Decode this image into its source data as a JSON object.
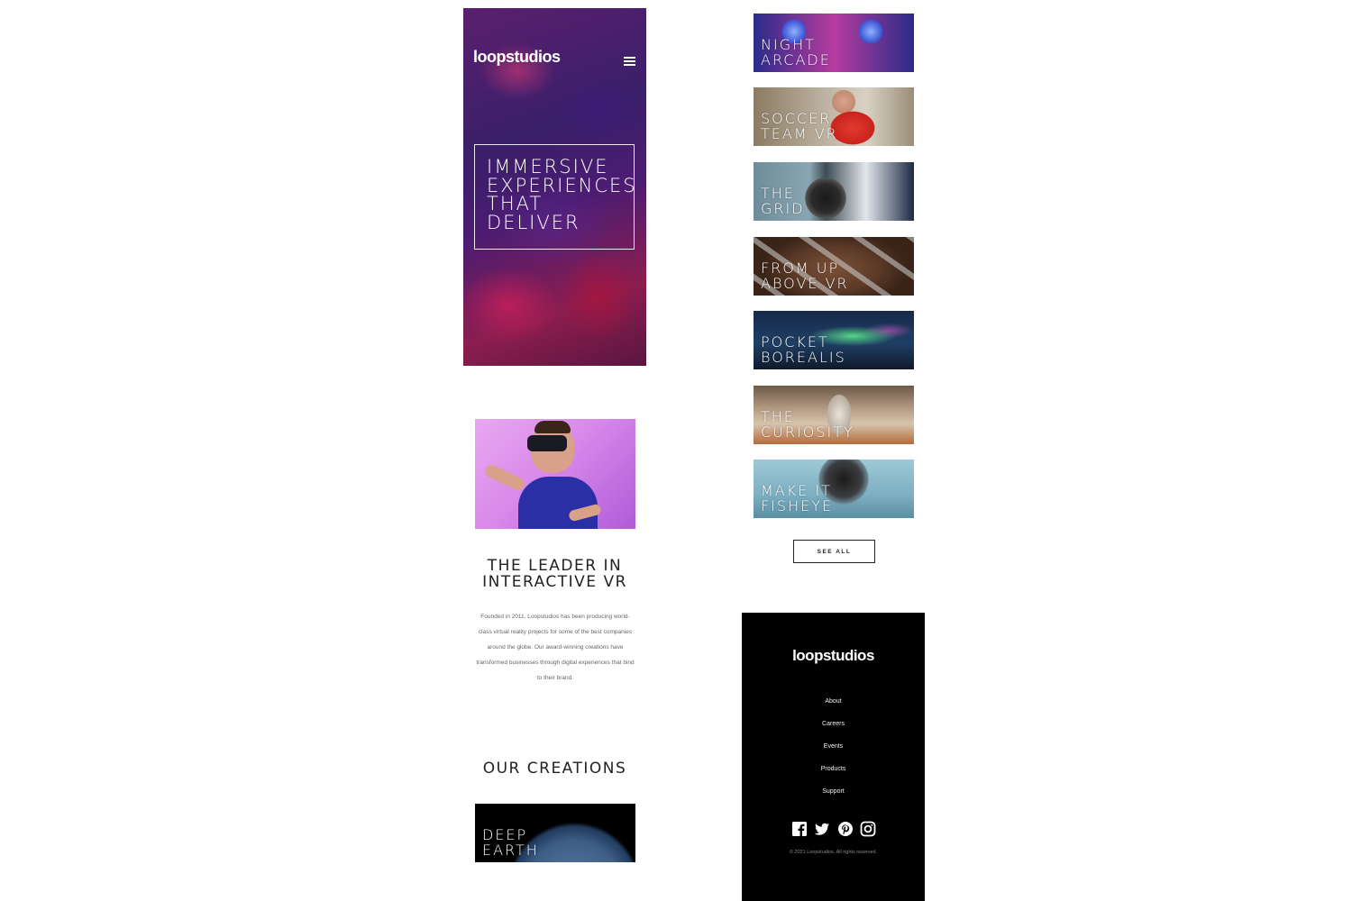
{
  "brand": {
    "name": "loopstudios"
  },
  "hero": {
    "title": "IMMERSIVE\nEXPERIENCES\nTHAT\nDELIVER",
    "menu_icon": "hamburger-icon"
  },
  "interactive": {
    "title": "THE LEADER IN\nINTERACTIVE VR",
    "text": "Founded in 2011, Loopstudios has been producing world-class virtual reality projects for some of the best companies around the globe. Our award-winning creations have transformed businesses through digital experiences that bind to their brand."
  },
  "creations": {
    "title": "OUR CREATIONS",
    "items": [
      {
        "label": "DEEP\nEARTH"
      },
      {
        "label": "NIGHT\nARCADE"
      },
      {
        "label": "SOCCER\nTEAM VR"
      },
      {
        "label": "THE\nGRID"
      },
      {
        "label": "FROM UP\nABOVE VR"
      },
      {
        "label": "POCKET\nBOREALIS"
      },
      {
        "label": "THE\nCURIOSITY"
      },
      {
        "label": "MAKE IT\nFISHEYE"
      }
    ],
    "see_all": "SEE ALL"
  },
  "footer": {
    "logo": "loopstudios",
    "nav": [
      "About",
      "Careers",
      "Events",
      "Products",
      "Support"
    ],
    "socials": [
      "facebook-icon",
      "twitter-icon",
      "pinterest-icon",
      "instagram-icon"
    ],
    "copyright": "© 2021 Loopstudios. All rights reserved."
  },
  "colors": {
    "hero_purple": "#4b1c72",
    "hero_magenta": "#8c1d4f",
    "footer_bg": "#000000",
    "text_dark": "#222222",
    "text_muted": "#666666"
  }
}
